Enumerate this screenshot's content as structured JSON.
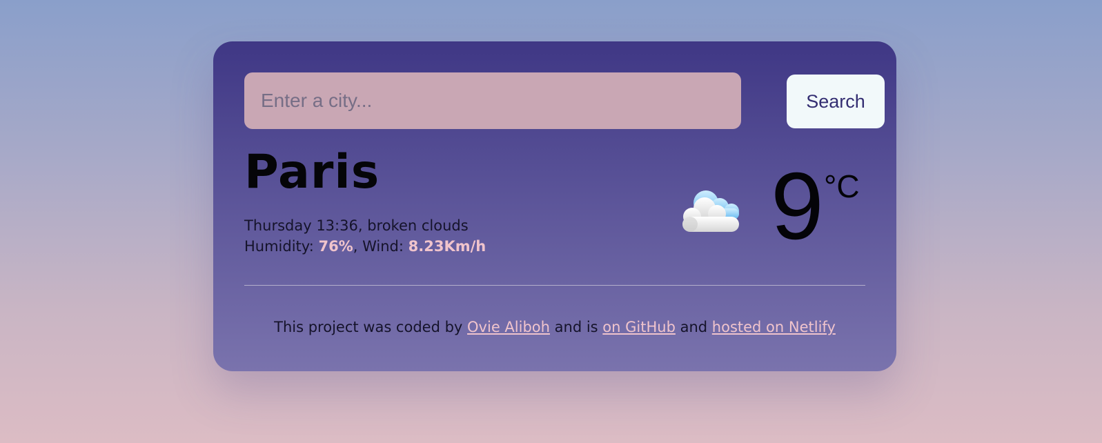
{
  "search": {
    "placeholder": "Enter a city...",
    "value": "",
    "button_label": "Search"
  },
  "weather": {
    "city": "Paris",
    "day_time": "Thursday 13:36",
    "description": "broken clouds",
    "humidity_label": "Humidity:",
    "humidity_value": "76%",
    "wind_label": "Wind:",
    "wind_value": "8.23Km/h",
    "temperature": "9",
    "unit": "°C",
    "icon": "broken-clouds-icon"
  },
  "footer": {
    "text_1": "This project was coded by",
    "author_link": "Ovie Aliboh",
    "text_2": "and is",
    "github_link": "on GitHub",
    "text_3": "and",
    "netlify_link": "hosted on Netlify"
  },
  "colors": {
    "card_top": "#3f3785",
    "card_bottom": "#7a73ad",
    "input_bg": "#c9a7b4",
    "button_bg": "#f2f9fa",
    "accent": "#f0c4cc"
  }
}
